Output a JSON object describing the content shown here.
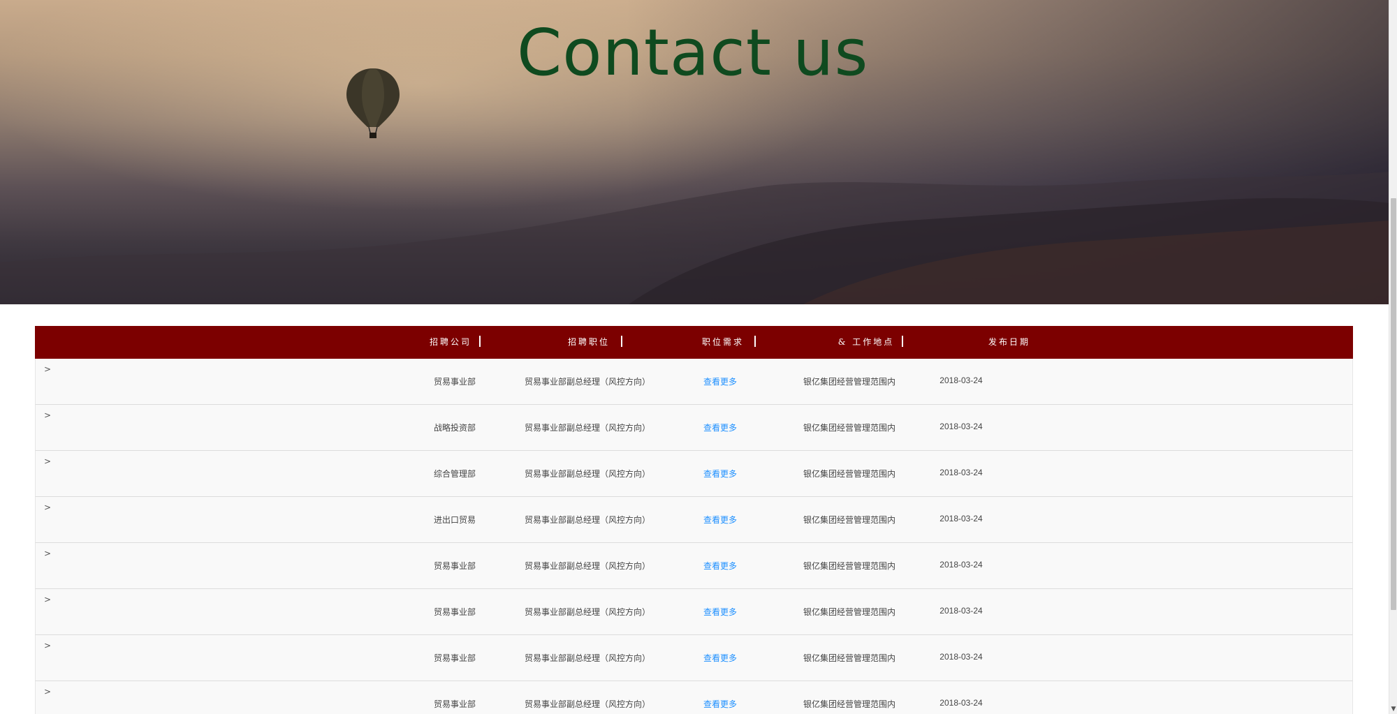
{
  "banner": {
    "title": "Contact us"
  },
  "table": {
    "headers": [
      "招聘公司",
      "招聘职位",
      "职位需求",
      "& 工作地点",
      "发布日期"
    ],
    "row_marker": ">",
    "rows": [
      {
        "company": "贸易事业部",
        "position": "贸易事业部副总经理（风控方向）",
        "requirement": "查看更多",
        "location": "银亿集团经营管理范围内",
        "date": "2018-03-24"
      },
      {
        "company": "战略投资部",
        "position": "贸易事业部副总经理（风控方向）",
        "requirement": "查看更多",
        "location": "银亿集团经营管理范围内",
        "date": "2018-03-24"
      },
      {
        "company": "综合管理部",
        "position": "贸易事业部副总经理（风控方向）",
        "requirement": "查看更多",
        "location": "银亿集团经营管理范围内",
        "date": "2018-03-24"
      },
      {
        "company": "进出口贸易",
        "position": "贸易事业部副总经理（风控方向）",
        "requirement": "查看更多",
        "location": "银亿集团经营管理范围内",
        "date": "2018-03-24"
      },
      {
        "company": "贸易事业部",
        "position": "贸易事业部副总经理（风控方向）",
        "requirement": "查看更多",
        "location": "银亿集团经营管理范围内",
        "date": "2018-03-24"
      },
      {
        "company": "贸易事业部",
        "position": "贸易事业部副总经理（风控方向）",
        "requirement": "查看更多",
        "location": "银亿集团经营管理范围内",
        "date": "2018-03-24"
      },
      {
        "company": "贸易事业部",
        "position": "贸易事业部副总经理（风控方向）",
        "requirement": "查看更多",
        "location": "银亿集团经营管理范围内",
        "date": "2018-03-24"
      },
      {
        "company": "贸易事业部",
        "position": "贸易事业部副总经理（风控方向）",
        "requirement": "查看更多",
        "location": "银亿集团经营管理范围内",
        "date": "2018-03-24"
      }
    ]
  },
  "scrollbar": {
    "down_arrow_icon": "chevron-down-icon"
  },
  "colors": {
    "header_bg": "#7c0000",
    "link": "#1e90ff",
    "title": "#0f4a1f"
  }
}
